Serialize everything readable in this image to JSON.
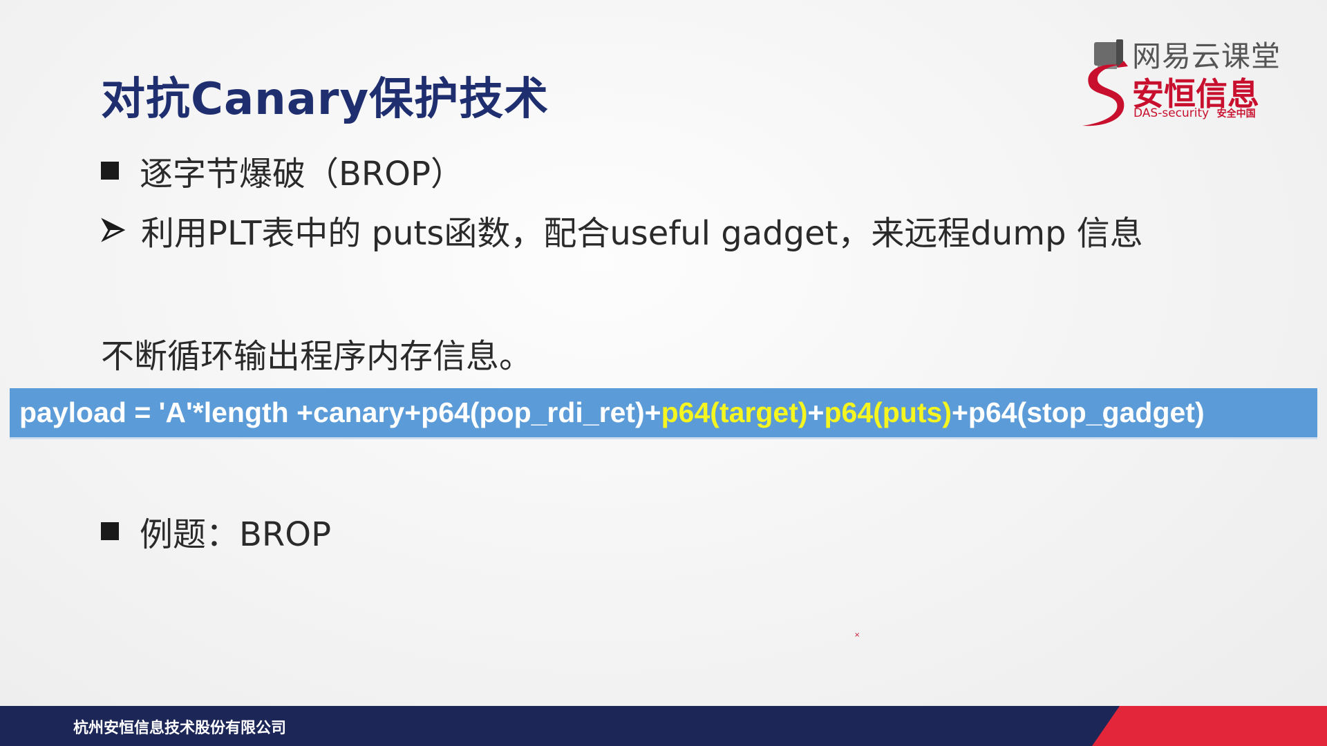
{
  "slide": {
    "title": "对抗Canary保护技术",
    "bullets": {
      "item1": "逐字节爆破（BROP）",
      "item2": "利用PLT表中的 puts函数，配合useful gadget，来远程dump 信息",
      "item3": "不断循环输出程序内存信息。",
      "item4": "例题：BROP"
    },
    "payload": {
      "part1": "payload = 'A'*length +canary+p64(pop_rdi_ret)+",
      "part2": "p64(target)",
      "part3": "+",
      "part4": "p64(puts)",
      "part5": "+p64(stop_gadget)"
    },
    "colors": {
      "title": "#1f2e6e",
      "payload_bg": "#5b9bd8",
      "payload_highlight": "#f5f51f",
      "footer_navy": "#1c2657",
      "footer_red": "#e3263a",
      "brand_red": "#c8102e"
    }
  },
  "logos": {
    "netease": "网易云课堂",
    "das_name": "安恒信息",
    "das_sub": "DAS-security",
    "das_sub_zh": "安全中国"
  },
  "footer": {
    "company": "杭州安恒信息技术股份有限公司"
  },
  "icons": {
    "square_bullet": "square-bullet-icon",
    "arrow_bullet": "arrow-bullet-icon",
    "netease_logo": "netease-cloud-classroom-icon",
    "das_logo": "das-security-s-icon"
  }
}
